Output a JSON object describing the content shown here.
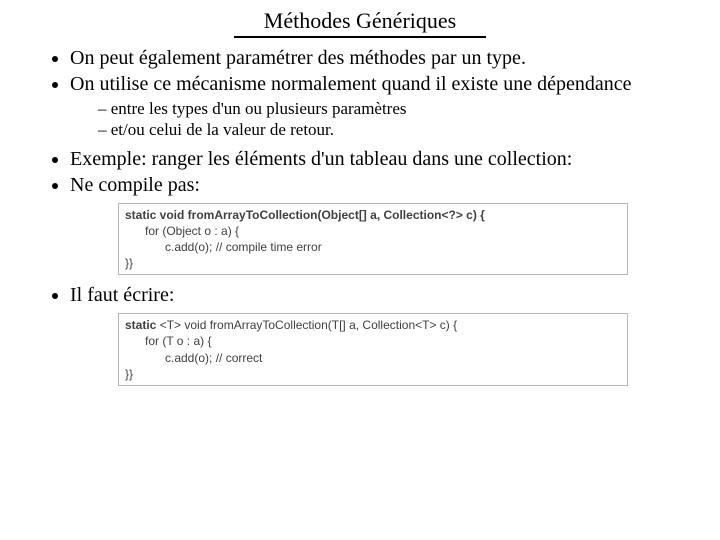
{
  "title": "Méthodes Génériques",
  "bullets": {
    "b1": "On peut également paramétrer des méthodes par un type.",
    "b2": "On utilise ce mécanisme normalement quand il existe une dépendance",
    "s1": "entre les types d'un ou plusieurs paramètres",
    "s2": "et/ou celui de la valeur de retour.",
    "b3": "Exemple: ranger les éléments d'un tableau dans une collection:",
    "b4": "Ne compile pas:",
    "b5": "Il faut écrire:"
  },
  "code1": {
    "l1": "static void fromArrayToCollection(Object[] a, Collection<?> c) {",
    "l2": "for (Object o : a) {",
    "l3": "c.add(o); // compile time error",
    "l4": "}}"
  },
  "code2": {
    "l1a": "static ",
    "l1b": "<T> void fromArrayToCollection(T[] a, Collection<T> c) {",
    "l2": "for (T o : a) {",
    "l3": "c.add(o); // correct",
    "l4": "}}"
  },
  "chart_data": null
}
